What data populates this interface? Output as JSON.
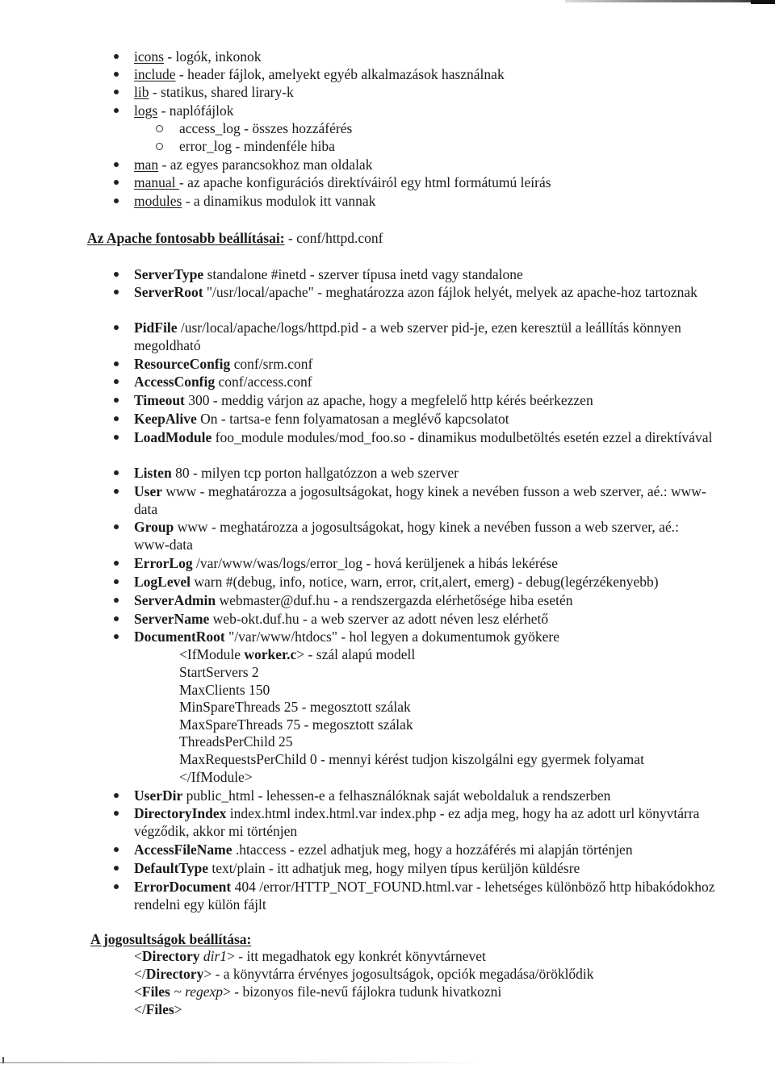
{
  "dir_list": [
    {
      "name": "icons",
      "desc": " - logók, inkonok"
    },
    {
      "name": "include",
      "desc": " - header fájlok, amelyekt egyéb alkalmazások használnak"
    },
    {
      "name": "lib",
      "desc": " - statikus, shared lirary-k"
    },
    {
      "name": "logs",
      "desc": " - naplófájlok"
    }
  ],
  "logs_sub": [
    "access_log - összes hozzáférés",
    "error_log - mindenféle hiba"
  ],
  "dir_list2": [
    {
      "name": "man",
      "desc": " - az egyes parancsokhoz man oldalak"
    },
    {
      "name": "manual ",
      "desc": "- az apache konfigurációs direktíváiról egy html formátumú leírás"
    },
    {
      "name": "modules",
      "desc": " - a dinamikus modulok itt vannak"
    }
  ],
  "section1": {
    "title": "Az Apache fontosabb beállításai:",
    "suffix": " - conf/httpd.conf"
  },
  "directives": [
    {
      "key": "ServerType",
      "text": " standalone #inetd - szerver típusa inetd vagy standalone"
    },
    {
      "key": "ServerRoot",
      "text": " \"/usr/local/apache\" - meghatározza azon fájlok helyét, melyek az apache-hoz tartoznak"
    },
    {
      "key": "PidFile",
      "text": " /usr/local/apache/logs/httpd.pid - a web szerver pid-je, ezen keresztül a leállítás könnyen megoldható"
    },
    {
      "key": "ResourceConfig",
      "text": " conf/srm.conf"
    },
    {
      "key": "AccessConfig",
      "text": " conf/access.conf"
    },
    {
      "key": "Timeout",
      "text": " 300 - meddig várjon az apache, hogy a megfelelő http kérés beérkezzen"
    },
    {
      "key": "KeepAlive",
      "text": " On - tartsa-e fenn folyamatosan a meglévő kapcsolatot"
    },
    {
      "key": "LoadModule",
      "text": " foo_module modules/mod_foo.so - dinamikus modulbetöltés esetén ezzel a direktívával"
    },
    {
      "key": "Listen",
      "text": " 80 - milyen tcp porton hallgatózzon a web szerver"
    },
    {
      "key": "User",
      "text": " www - meghatározza a jogosultságokat, hogy kinek a nevében fusson a web szerver, aé.: www-data"
    },
    {
      "key": "Group",
      "text": " www - meghatározza a jogosultságokat, hogy kinek a nevében fusson a web szerver, aé.: www-data"
    },
    {
      "key": "ErrorLog",
      "text": " /var/www/was/logs/error_log - hová kerüljenek a hibás lekérése"
    },
    {
      "key": "LogLevel",
      "text": " warn #(debug, info, notice, warn, error, crit,alert, emerg) - debug(legérzékenyebb)"
    },
    {
      "key": "ServerAdmin",
      "text": " webmaster@duf.hu - a rendszergazda elérhetősége hiba esetén"
    },
    {
      "key": "ServerName",
      "text": " web-okt.duf.hu - a web szerver az adott néven lesz elérhető"
    },
    {
      "key": "DocumentRoot",
      "text": " \"/var/www/htdocs\" - hol legyen a dokumentumok gyökere"
    }
  ],
  "ifmodule": {
    "open_pre": "<IfModule ",
    "open_bold": "worker.c",
    "open_post": "> - szál alapú modell",
    "lines": [
      "StartServers 2",
      "MaxClients 150",
      "MinSpareThreads 25 - megosztott szálak",
      "MaxSpareThreads 75 - megosztott szálak",
      "ThreadsPerChild 25",
      "MaxRequestsPerChild 0 - mennyi kérést tudjon kiszolgálni egy gyermek folyamat"
    ],
    "close": "</IfModule>"
  },
  "directives2": [
    {
      "key": "UserDir",
      "text": " public_html - lehessen-e a felhasználóknak saját weboldaluk a rendszerben"
    },
    {
      "key": "DirectoryIndex",
      "text": " index.html index.html.var index.php - ez adja meg, hogy ha az adott url könyvtárra végződik, akkor mi történjen"
    },
    {
      "key": "AccessFileName",
      "text": " .htaccess - ezzel adhatjuk meg, hogy a hozzáférés mi alapján történjen"
    },
    {
      "key": "DefaultType",
      "text": " text/plain - itt adhatjuk meg, hogy milyen típus kerüljön küldésre"
    },
    {
      "key": "ErrorDocument",
      "text": " 404 /error/HTTP_NOT_FOUND.html.var - lehetséges különböző http hibakódokhoz rendelni egy külön fájlt"
    }
  ],
  "section2": {
    "title": "A jogosultságok beállítása:",
    "lines": [
      {
        "pre": "<",
        "bold": "Directory",
        "italic": " dir1",
        "post": "> - itt megadhatok egy konkrét könyvtárnevet"
      },
      {
        "pre": "</",
        "bold": "Directory",
        "italic": "",
        "post": "> - a könyvtárra érvényes jogosultságok, opciók megadása/öröklődik"
      },
      {
        "pre": "<",
        "bold": "Files",
        "italic": " ~ regexp",
        "post": "> - bizonyos file-nevű fájlokra tudunk hivatkozni"
      },
      {
        "pre": "</",
        "bold": "Files",
        "italic": "",
        "post": ">"
      }
    ]
  }
}
